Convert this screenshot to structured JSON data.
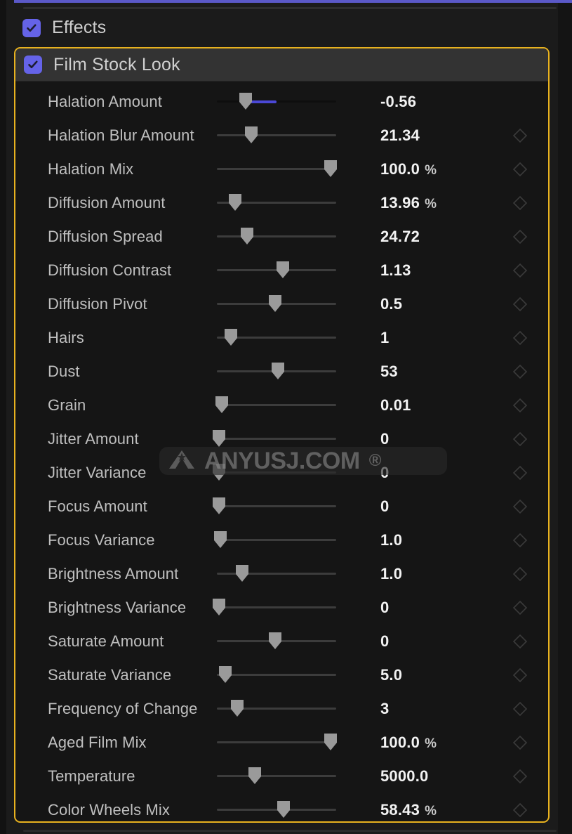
{
  "window": {
    "background_color": "#1b1b1b",
    "accent_color": "#5b59c8",
    "selected_border_color": "#e8b21f",
    "checkbox_color": "#6563e8"
  },
  "effects_section": {
    "label": "Effects",
    "checkbox_checked": true,
    "checkbox_icon": "checkmark-icon"
  },
  "effect": {
    "title": "Film Stock Look",
    "checkbox_checked": true,
    "checkbox_icon": "checkmark-icon",
    "selected": true,
    "parameters": [
      {
        "label": "Halation Amount",
        "value": "-0.56",
        "unit": "",
        "slider_percent": 24,
        "fill_percent": 26,
        "fill_start_percent": 24,
        "has_fill": true,
        "has_keyframe": false,
        "track_style": "dark"
      },
      {
        "label": "Halation Blur Amount",
        "value": "21.34",
        "unit": "",
        "slider_percent": 29,
        "has_fill": false,
        "has_keyframe": true,
        "track_style": "normal"
      },
      {
        "label": "Halation Mix",
        "value": "100.0",
        "unit": "%",
        "slider_percent": 95,
        "has_fill": false,
        "has_keyframe": true,
        "track_style": "normal"
      },
      {
        "label": "Diffusion Amount",
        "value": "13.96",
        "unit": "%",
        "slider_percent": 15,
        "has_fill": false,
        "has_keyframe": true,
        "track_style": "normal"
      },
      {
        "label": "Diffusion Spread",
        "value": "24.72",
        "unit": "",
        "slider_percent": 25,
        "has_fill": false,
        "has_keyframe": true,
        "track_style": "normal"
      },
      {
        "label": "Diffusion Contrast",
        "value": "1.13",
        "unit": "",
        "slider_percent": 55,
        "has_fill": false,
        "has_keyframe": true,
        "track_style": "normal"
      },
      {
        "label": "Diffusion Pivot",
        "value": "0.5",
        "unit": "",
        "slider_percent": 49,
        "has_fill": false,
        "has_keyframe": true,
        "track_style": "normal"
      },
      {
        "label": "Hairs",
        "value": "1",
        "unit": "",
        "slider_percent": 12,
        "has_fill": false,
        "has_keyframe": true,
        "track_style": "normal"
      },
      {
        "label": "Dust",
        "value": "53",
        "unit": "",
        "slider_percent": 51,
        "has_fill": false,
        "has_keyframe": true,
        "track_style": "normal"
      },
      {
        "label": "Grain",
        "value": "0.01",
        "unit": "",
        "slider_percent": 4,
        "has_fill": false,
        "has_keyframe": true,
        "track_style": "normal"
      },
      {
        "label": "Jitter Amount",
        "value": "0",
        "unit": "",
        "slider_percent": 2,
        "has_fill": false,
        "has_keyframe": true,
        "track_style": "normal"
      },
      {
        "label": "Jitter Variance",
        "value": "0",
        "unit": "",
        "slider_percent": 2,
        "has_fill": false,
        "has_keyframe": true,
        "track_style": "normal"
      },
      {
        "label": "Focus Amount",
        "value": "0",
        "unit": "",
        "slider_percent": 2,
        "has_fill": false,
        "has_keyframe": true,
        "track_style": "normal"
      },
      {
        "label": "Focus Variance",
        "value": "1.0",
        "unit": "",
        "slider_percent": 3,
        "has_fill": false,
        "has_keyframe": true,
        "track_style": "normal"
      },
      {
        "label": "Brightness Amount",
        "value": "1.0",
        "unit": "",
        "slider_percent": 21,
        "has_fill": false,
        "has_keyframe": true,
        "track_style": "normal"
      },
      {
        "label": "Brightness Variance",
        "value": "0",
        "unit": "",
        "slider_percent": 2,
        "has_fill": false,
        "has_keyframe": true,
        "track_style": "normal"
      },
      {
        "label": "Saturate Amount",
        "value": "0",
        "unit": "",
        "slider_percent": 49,
        "has_fill": false,
        "has_keyframe": true,
        "track_style": "normal"
      },
      {
        "label": "Saturate Variance",
        "value": "5.0",
        "unit": "",
        "slider_percent": 7,
        "has_fill": false,
        "has_keyframe": true,
        "track_style": "normal"
      },
      {
        "label": "Frequency of Change",
        "value": "3",
        "unit": "",
        "slider_percent": 17,
        "has_fill": false,
        "has_keyframe": true,
        "track_style": "normal"
      },
      {
        "label": "Aged Film Mix",
        "value": "100.0",
        "unit": "%",
        "slider_percent": 95,
        "has_fill": false,
        "has_keyframe": true,
        "track_style": "normal"
      },
      {
        "label": "Temperature",
        "value": "5000.0",
        "unit": "",
        "slider_percent": 32,
        "has_fill": false,
        "has_keyframe": true,
        "track_style": "normal"
      },
      {
        "label": "Color Wheels Mix",
        "value": "58.43",
        "unit": "%",
        "slider_percent": 56,
        "has_fill": false,
        "has_keyframe": true,
        "track_style": "normal"
      }
    ]
  },
  "watermark": {
    "text": "ANYUSJ.COM",
    "registered_mark": "®",
    "logo_icon": "anyusj-triangle-star-logo-icon"
  }
}
